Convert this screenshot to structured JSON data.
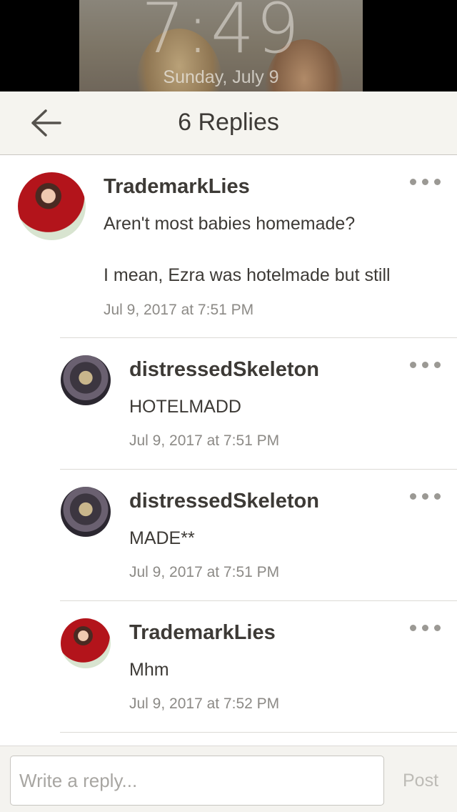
{
  "lock_screen": {
    "time": "7:49",
    "date": "Sunday, July 9"
  },
  "nav": {
    "title": "6 Replies",
    "back_icon": "arrow-left-icon"
  },
  "comments": [
    {
      "username": "TrademarkLies",
      "body": "Aren't most babies homemade?\n\nI mean, Ezra was hotelmade but still",
      "timestamp": "Jul 9, 2017 at 7:51 PM",
      "avatar": "red-robe-avatar"
    },
    {
      "username": "distressedSkeleton",
      "body": "HOTELMADD",
      "timestamp": "Jul 9, 2017 at 7:51 PM",
      "avatar": "dark-hair-avatar"
    },
    {
      "username": "distressedSkeleton",
      "body": "MADE**",
      "timestamp": "Jul 9, 2017 at 7:51 PM",
      "avatar": "dark-hair-avatar"
    },
    {
      "username": "TrademarkLies",
      "body": "Mhm",
      "timestamp": "Jul 9, 2017 at 7:52 PM",
      "avatar": "red-robe-avatar"
    }
  ],
  "reply": {
    "placeholder": "Write a reply...",
    "post_label": "Post"
  },
  "colors": {
    "nav_background": "#f5f4ef",
    "text": "#3d3a36",
    "muted": "#8c8a86"
  }
}
